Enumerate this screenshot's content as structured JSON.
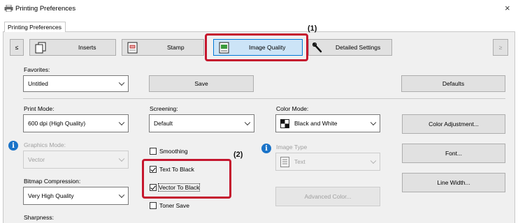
{
  "window": {
    "title": "Printing Preferences",
    "close": "×"
  },
  "tabs": [
    {
      "label": "Printing Preferences"
    }
  ],
  "toolbar": {
    "prev": "≤",
    "next": "≥",
    "buttons": [
      {
        "label": "Inserts"
      },
      {
        "label": "Stamp"
      },
      {
        "label": "Image Quality"
      },
      {
        "label": "Detailed Settings"
      }
    ]
  },
  "favorites": {
    "label": "Favorites:",
    "value": "Untitled",
    "save": "Save",
    "defaults": "Defaults"
  },
  "print_mode": {
    "label": "Print Mode:",
    "value": "600 dpi (High Quality)"
  },
  "graphics_mode": {
    "label": "Graphics Mode:",
    "value": "Vector"
  },
  "bitmap_compression": {
    "label": "Bitmap Compression:",
    "value": "Very High Quality"
  },
  "sharpness": {
    "label": "Sharpness:"
  },
  "screening": {
    "label": "Screening:",
    "value": "Default"
  },
  "checkboxes": {
    "smoothing": {
      "label": "Smoothing",
      "checked": false
    },
    "text_to_black": {
      "label": "Text To Black",
      "checked": true
    },
    "vector_to_black": {
      "label": "Vector To Black",
      "checked": true
    },
    "toner_save": {
      "label": "Toner Save",
      "checked": false
    }
  },
  "color_mode": {
    "label": "Color Mode:",
    "value": "Black and White"
  },
  "image_type": {
    "label": "Image Type",
    "value": "Text"
  },
  "advanced_color": "Advanced Color...",
  "color_adjustment": "Color Adjustment...",
  "font": "Font...",
  "line_width": "Line Width...",
  "callouts": {
    "one": "(1)",
    "two": "(2)"
  },
  "colors": {
    "highlight": "#c5162e",
    "selected_tab": "#cce4f7",
    "accent": "#0078d7"
  }
}
